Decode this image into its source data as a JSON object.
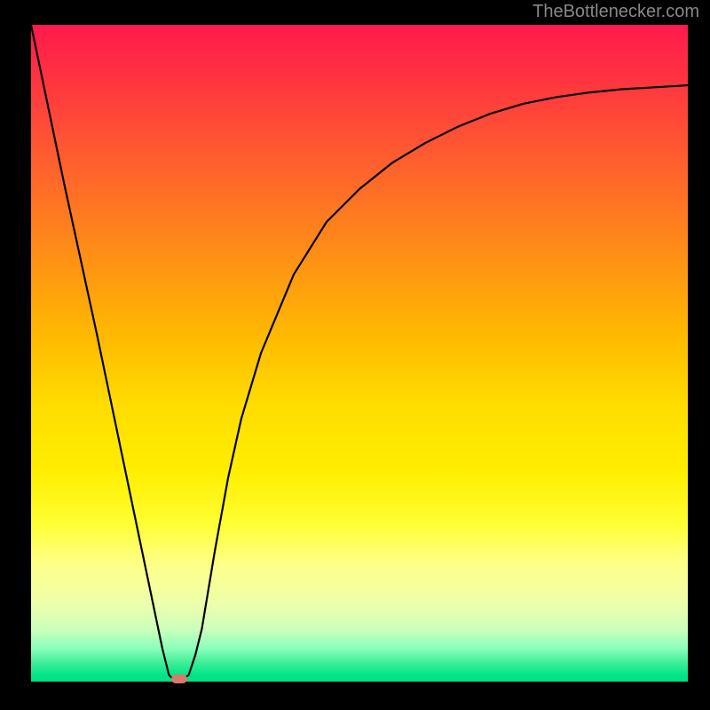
{
  "attribution": "TheBottlenecker.com",
  "chart_data": {
    "type": "line",
    "title": "",
    "xlabel": "",
    "ylabel": "",
    "xlim": [
      0,
      100
    ],
    "ylim": [
      0,
      100
    ],
    "background": "rainbow-gradient-red-to-green",
    "curve": {
      "x": [
        0,
        5,
        10,
        15,
        20,
        21,
        22,
        23,
        24,
        25,
        26,
        28,
        30,
        32,
        35,
        40,
        45,
        50,
        55,
        60,
        65,
        70,
        75,
        80,
        85,
        90,
        95,
        100
      ],
      "y_pct": [
        100,
        76,
        53,
        29,
        5,
        1,
        0,
        0.3,
        1,
        4,
        8,
        20,
        31,
        40,
        50,
        62,
        70,
        75,
        79,
        82,
        84.5,
        86.5,
        88,
        89,
        89.7,
        90.2,
        90.5,
        90.8
      ]
    },
    "marker": {
      "x": 22.5,
      "y_pct": 0,
      "shape": "rounded-rect",
      "color": "#d87a6a"
    }
  }
}
